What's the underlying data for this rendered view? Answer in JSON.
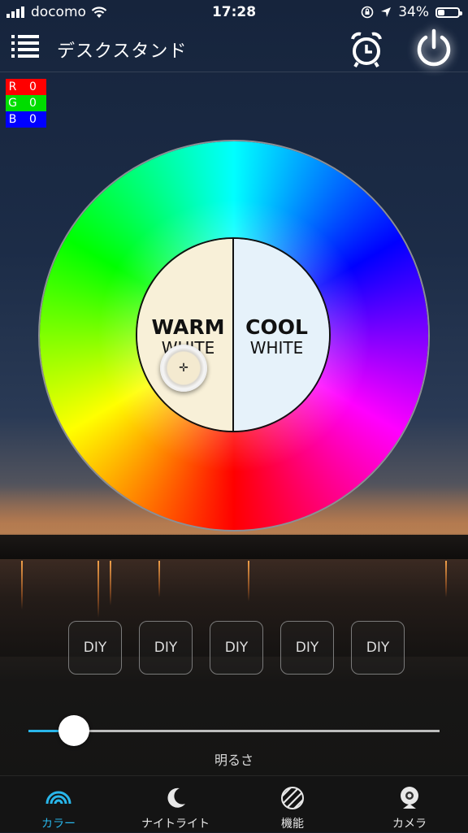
{
  "status_bar": {
    "carrier": "docomo",
    "time": "17:28",
    "battery_percent": "34%",
    "battery_level": 0.34
  },
  "header": {
    "title": "デスクスタンド"
  },
  "rgb": {
    "r_label": "R",
    "r_value": "0",
    "g_label": "G",
    "g_value": "0",
    "b_label": "B",
    "b_value": "0",
    "colors": {
      "r": "#ff0000",
      "g": "#00dd00",
      "b": "#0000ff"
    }
  },
  "color_wheel": {
    "warm_line1": "WARM",
    "warm_line2": "WHITE",
    "cool_line1": "COOL",
    "cool_line2": "WHITE",
    "selector_icon": "crosshair-icon"
  },
  "diy_buttons": [
    "DIY",
    "DIY",
    "DIY",
    "DIY",
    "DIY"
  ],
  "brightness": {
    "label": "明るさ",
    "value": 0.11,
    "accent": "#29b6ea"
  },
  "tabs": [
    {
      "label": "カラー",
      "icon": "rainbow-icon",
      "active": true
    },
    {
      "label": "ナイトライト",
      "icon": "moon-icon",
      "active": false
    },
    {
      "label": "機能",
      "icon": "function-icon",
      "active": false
    },
    {
      "label": "カメラ",
      "icon": "camera-icon",
      "active": false
    }
  ]
}
